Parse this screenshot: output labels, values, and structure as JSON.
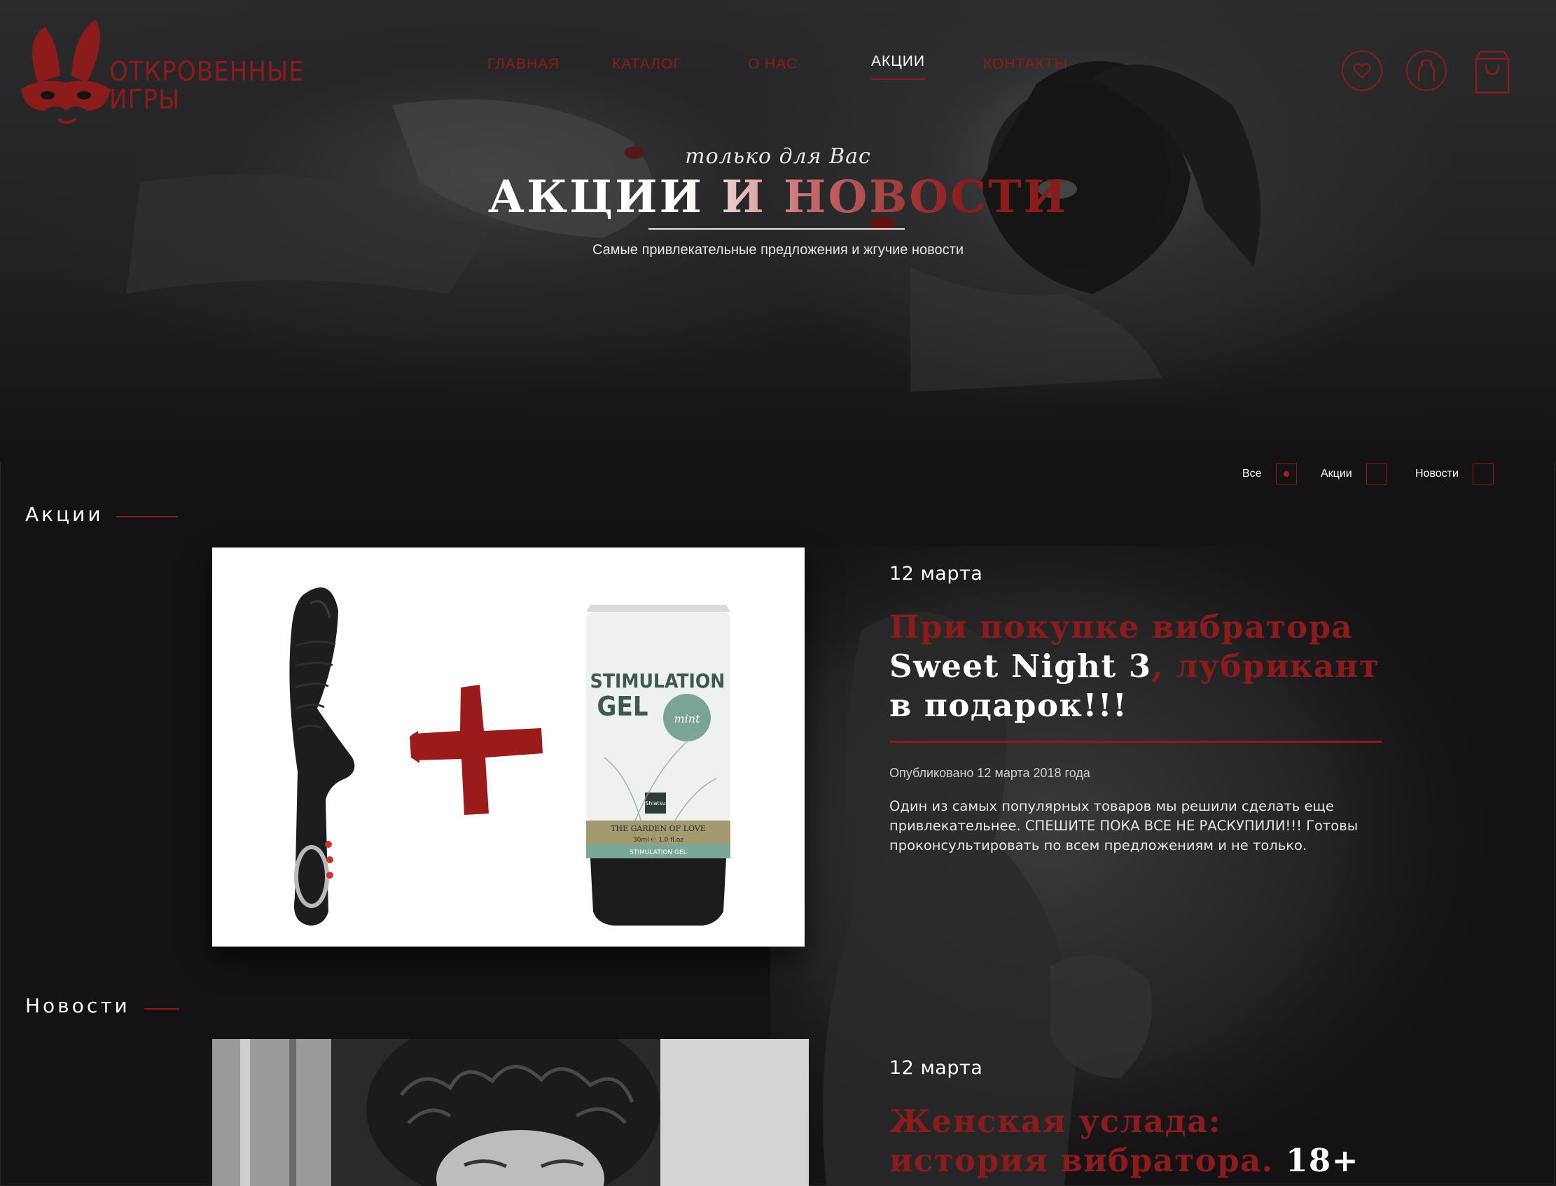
{
  "brand": {
    "name_line1": "ОТКРОВЕННЫЕ",
    "name_line2": "ИГРЫ",
    "accent_color": "#8c1c1c"
  },
  "nav": {
    "items": [
      {
        "label": "ГЛАВНАЯ",
        "active": false
      },
      {
        "label": "КАТАЛОГ",
        "active": false
      },
      {
        "label": "О НАС",
        "active": false
      },
      {
        "label": "АКЦИИ",
        "active": true
      },
      {
        "label": "КОНТАКТЫ",
        "active": false
      }
    ]
  },
  "header_icons": [
    "heart-icon",
    "user-icon",
    "shopping-bag-icon"
  ],
  "hero": {
    "subtitle": "только для Вас",
    "title": "АКЦИИ И НОВОСТИ",
    "description": "Самые привлекательные предложения и жгучие новости"
  },
  "filters": [
    {
      "label": "Все",
      "selected": true
    },
    {
      "label": "Акции",
      "selected": false
    },
    {
      "label": "Новости",
      "selected": false
    }
  ],
  "sections": {
    "promotions": {
      "title": "Акции",
      "post": {
        "date": "12 марта",
        "title_part1": "При покупке вибратора",
        "title_part2": "Sweet Night 3",
        "title_part3": ", лубрикант",
        "title_part4": "в подарок!!!",
        "meta": "Опубликовано 12 марта 2018 года",
        "text": "Один из самых популярных товаров мы решили сделать еще привлекательнее. СПЕШИТЕ ПОКА ВСЕ НЕ РАСКУПИЛИ!!! Готовы проконсультировать по всем предложениям и не только.",
        "image": {
          "tube_line1": "STIMULATION",
          "tube_line2": "GEL",
          "tube_badge": "mint",
          "tube_brand": "Shiatsu",
          "tube_band": "THE GARDEN OF LOVE",
          "tube_volume": "30ml ℮ 1.0 fl.oz",
          "tube_bottom": "STIMULATION GEL"
        }
      }
    },
    "news": {
      "title": "Новости",
      "post": {
        "date": "12 марта",
        "title_part1": "Женская услада:",
        "title_part2": "история вибратора.",
        "title_part3": "18+"
      }
    }
  }
}
